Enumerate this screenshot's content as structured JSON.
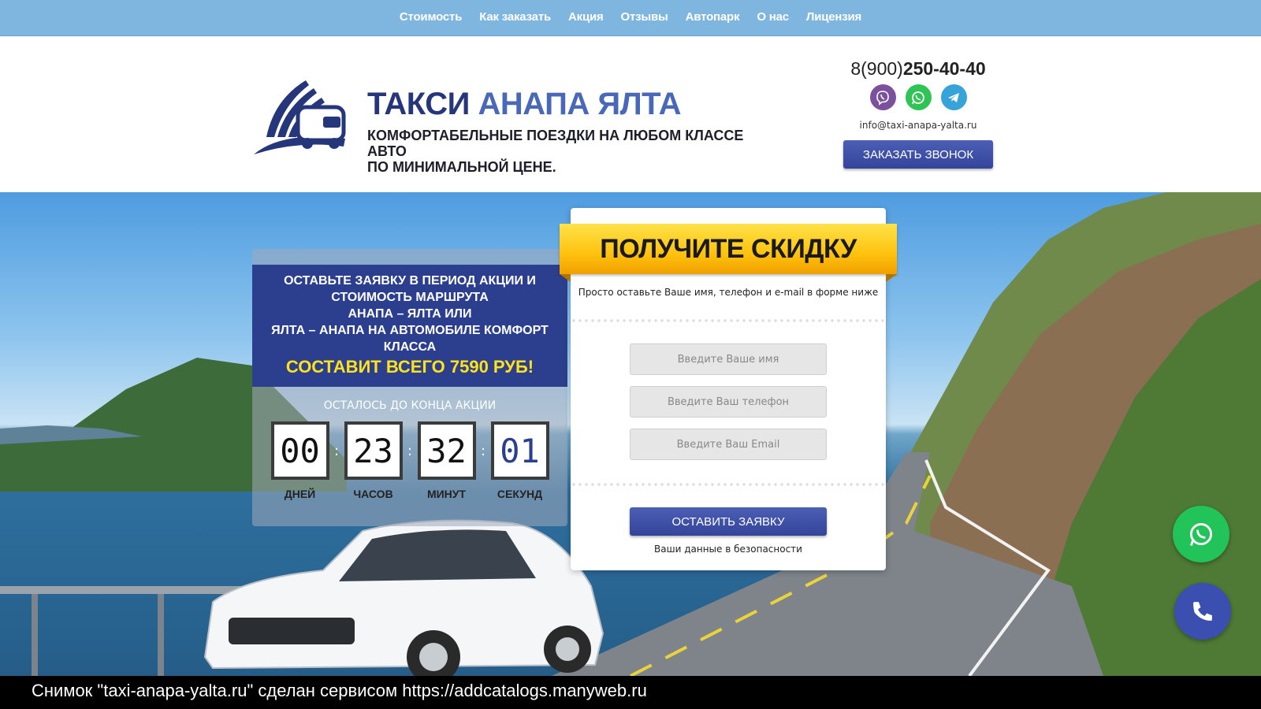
{
  "nav": {
    "items": [
      "Стоимость",
      "Как заказать",
      "Акция",
      "Отзывы",
      "Автопарк",
      "О нас",
      "Лицензия"
    ]
  },
  "header": {
    "brand_part1": "ТАКСИ",
    "brand_part2": "АНАПА ЯЛТА",
    "tagline_line1": "КОМФОРТАБЕЛЬНЫЕ ПОЕЗДКИ НА ЛЮБОМ КЛАССЕ АВТО",
    "tagline_line2": "ПО МИНИМАЛЬНОЙ ЦЕНЕ.",
    "phone_prefix": "8(900)",
    "phone_main": "250-40-40",
    "email": "info@taxi-anapa-yalta.ru",
    "callback_label": "ЗАКАЗАТЬ ЗВОНОК"
  },
  "promo": {
    "line1": "ОСТАВЬТЕ ЗАЯВКУ В ПЕРИОД АКЦИИ И",
    "line2": "СТОИМОСТЬ МАРШРУТА",
    "line3": "АНАПА – ЯЛТА ИЛИ",
    "line4": "ЯЛТА – АНАПА НА АВТОМОБИЛЕ КОМФОРТ",
    "line5": "КЛАССА",
    "price": "СОСТАВИТ ВСЕГО 7590 РУБ!",
    "timer_label": "ОСТАЛОСЬ ДО КОНЦА АКЦИИ",
    "days": "00",
    "hours": "23",
    "minutes": "32",
    "seconds": "01",
    "unit_days": "ДНЕЙ",
    "unit_hours": "ЧАСОВ",
    "unit_minutes": "МИНУТ",
    "unit_seconds": "СЕКУНД"
  },
  "form": {
    "title": "ПОЛУЧИТЕ СКИДКУ",
    "subtitle": "Просто оставьте Ваше имя, телефон и e-mail в форме ниже",
    "name_placeholder": "Введите Ваше имя",
    "phone_placeholder": "Введите Ваш телефон",
    "email_placeholder": "Введите Ваш Email",
    "submit_label": "ОСТАВИТЬ ЗАЯВКУ",
    "safe_note": "Ваши данные в безопасности"
  },
  "caption": "Снимок \"taxi-anapa-yalta.ru\" сделан сервисом https://addcatalogs.manyweb.ru",
  "icons": {
    "viber": "viber-icon",
    "whatsapp": "whatsapp-icon",
    "telegram": "telegram-icon",
    "phone": "phone-icon",
    "logo": "bus-logo-icon"
  },
  "colors": {
    "nav_bg": "#7fb6df",
    "brand_dark": "#26367a",
    "brand_light": "#4a68b8",
    "button": "#3a4ca6",
    "accent_yellow": "#ffe21a",
    "ribbon": "#ffc20e",
    "whatsapp": "#22c45a"
  }
}
